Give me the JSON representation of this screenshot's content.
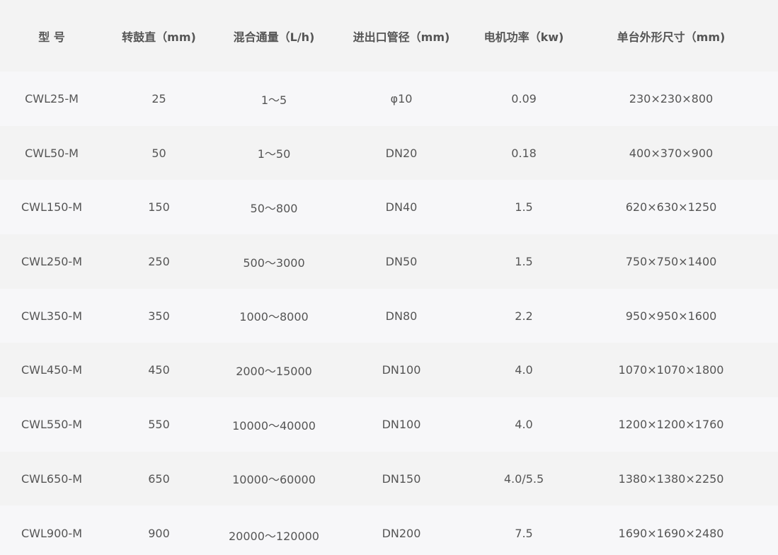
{
  "table": {
    "headers": [
      "型 号",
      "转鼓直（mm)",
      "混合通量（L/h)",
      "进出口管径（mm)",
      "电机功率（kw)",
      "单台外形尺寸（mm)"
    ],
    "rows": [
      [
        "CWL25-M",
        "25",
        "1～5",
        "φ10",
        "0.09",
        "230×230×800"
      ],
      [
        "CWL50-M",
        "50",
        "1～50",
        "DN20",
        "0.18",
        "400×370×900"
      ],
      [
        "CWL150-M",
        "150",
        "50～800",
        "DN40",
        "1.5",
        "620×630×1250"
      ],
      [
        "CWL250-M",
        "250",
        "500～3000",
        "DN50",
        "1.5",
        "750×750×1400"
      ],
      [
        "CWL350-M",
        "350",
        "1000～8000",
        "DN80",
        "2.2",
        "950×950×1600"
      ],
      [
        "CWL450-M",
        "450",
        "2000～15000",
        "DN100",
        "4.0",
        "1070×1070×1800"
      ],
      [
        "CWL550-M",
        "550",
        "10000～40000",
        "DN100",
        "4.0",
        "1200×1200×1760"
      ],
      [
        "CWL650-M",
        "650",
        "10000～60000",
        "DN150",
        "4.0/5.5",
        "1380×1380×2250"
      ],
      [
        "CWL900-M",
        "900",
        "20000～120000",
        "DN200",
        "7.5",
        "1690×1690×2480"
      ]
    ]
  },
  "colors": {
    "text": "#555555",
    "header_bg": "#f3f3f3",
    "row_odd_bg": "#f7f7f9",
    "row_even_bg": "#f3f3f3"
  }
}
